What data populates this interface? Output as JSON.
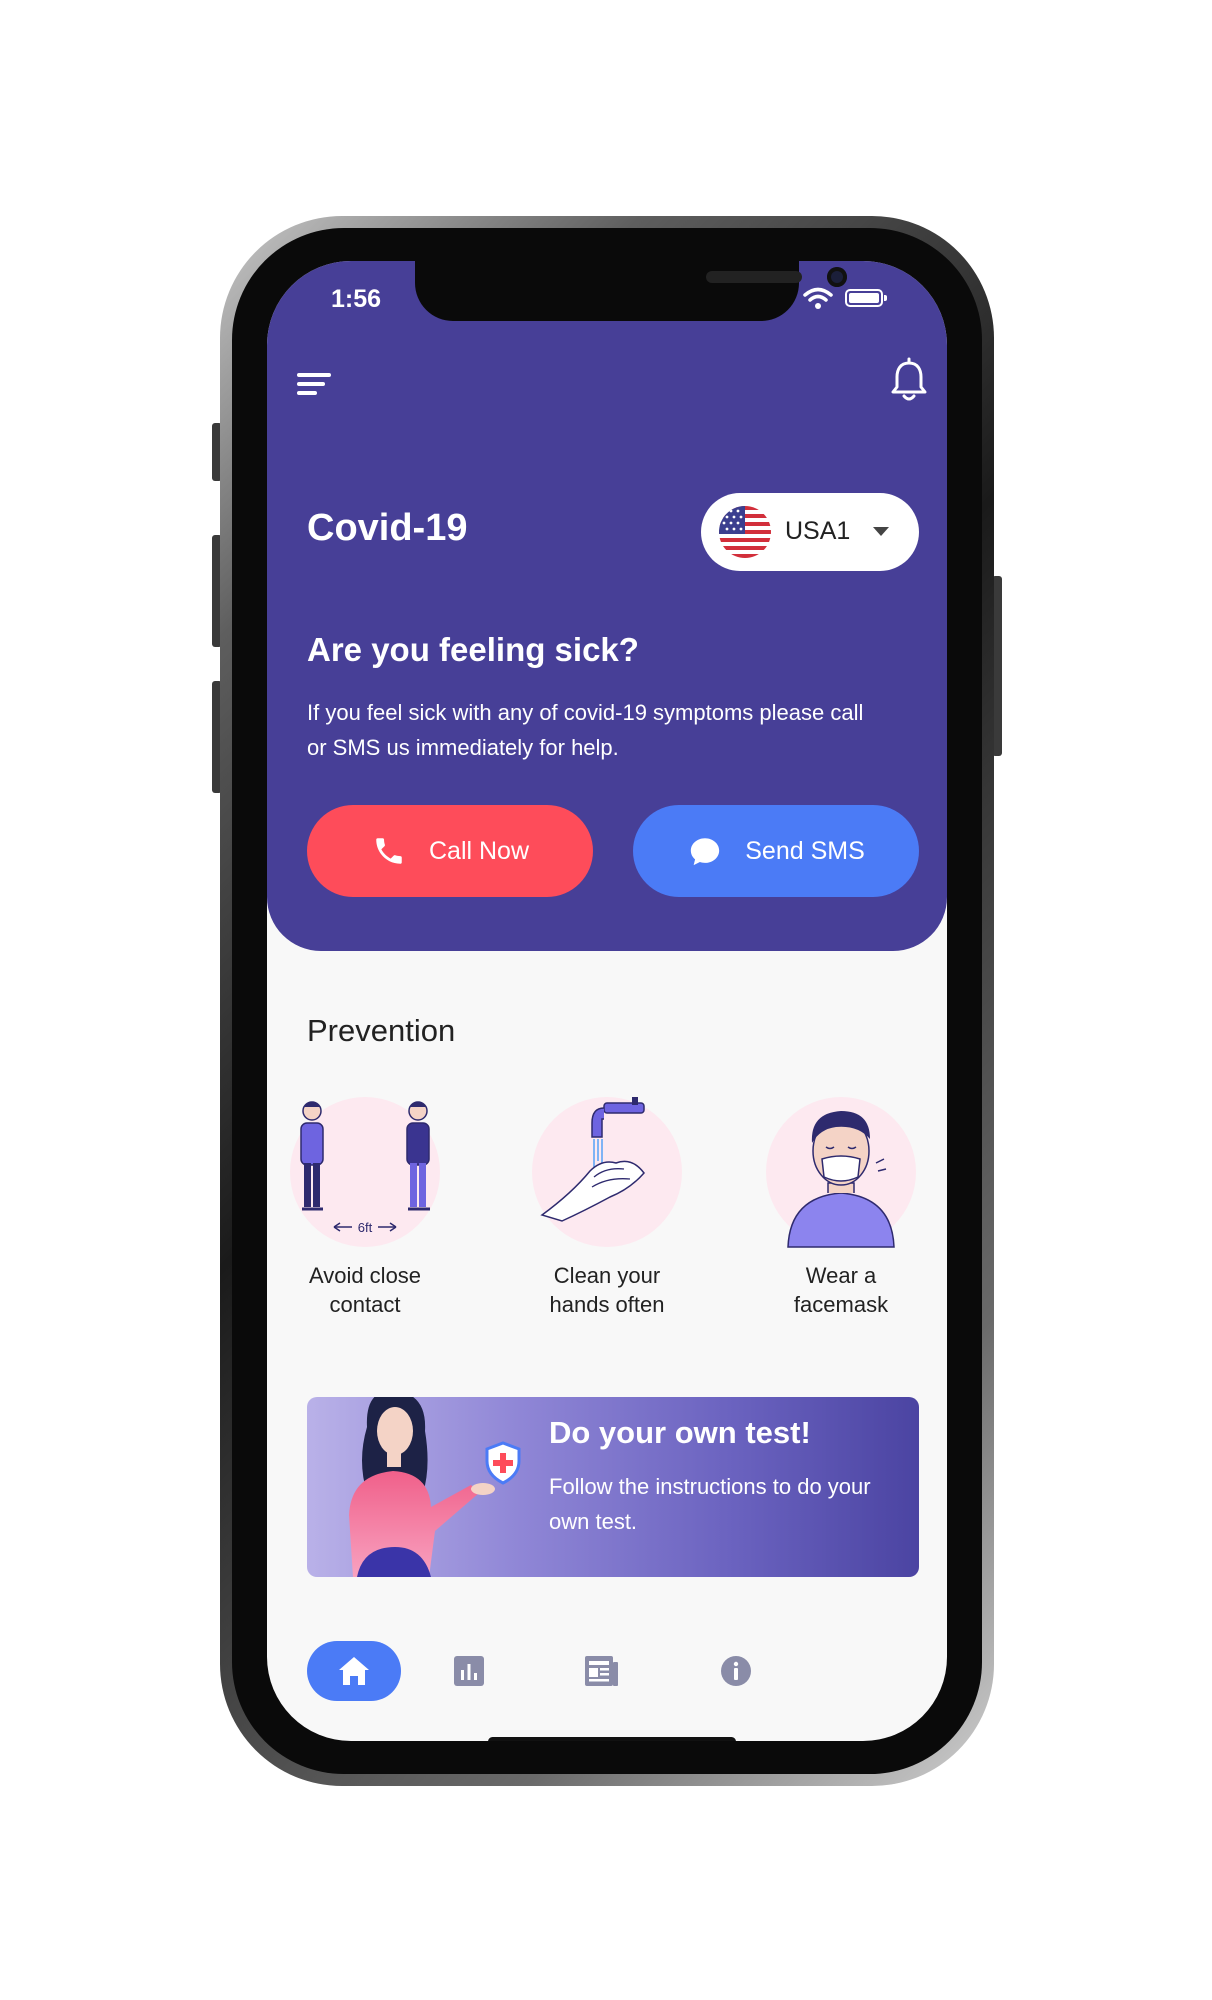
{
  "status_bar": {
    "time": "1:56"
  },
  "header": {
    "title": "Covid-19",
    "country_select": {
      "value": "USA1",
      "flag_icon": "us-flag-icon"
    }
  },
  "alert": {
    "title": "Are you feeling sick?",
    "description": "If you feel sick with any of covid-19 symptoms please call or SMS us immediately for help.",
    "call_button": "Call Now",
    "sms_button": "Send SMS"
  },
  "prevention": {
    "title": "Prevention",
    "items": [
      {
        "label_line1": "Avoid close",
        "label_line2": "contact",
        "distance_label": "6ft",
        "icon": "avoid-contact-illustration"
      },
      {
        "label_line1": "Clean your",
        "label_line2": "hands often",
        "icon": "wash-hands-illustration"
      },
      {
        "label_line1": "Wear a",
        "label_line2": "facemask",
        "icon": "facemask-illustration"
      }
    ]
  },
  "test_card": {
    "title": "Do your own test!",
    "description": "Follow the instructions to do your own test."
  },
  "bottom_nav": [
    "home-icon",
    "stats-icon",
    "news-icon",
    "info-icon"
  ],
  "colors": {
    "primary": "#473f97",
    "call": "#fe4c5a",
    "sms": "#4b7bf6",
    "background": "#f8f8f8",
    "pink": "#fde9f0"
  }
}
